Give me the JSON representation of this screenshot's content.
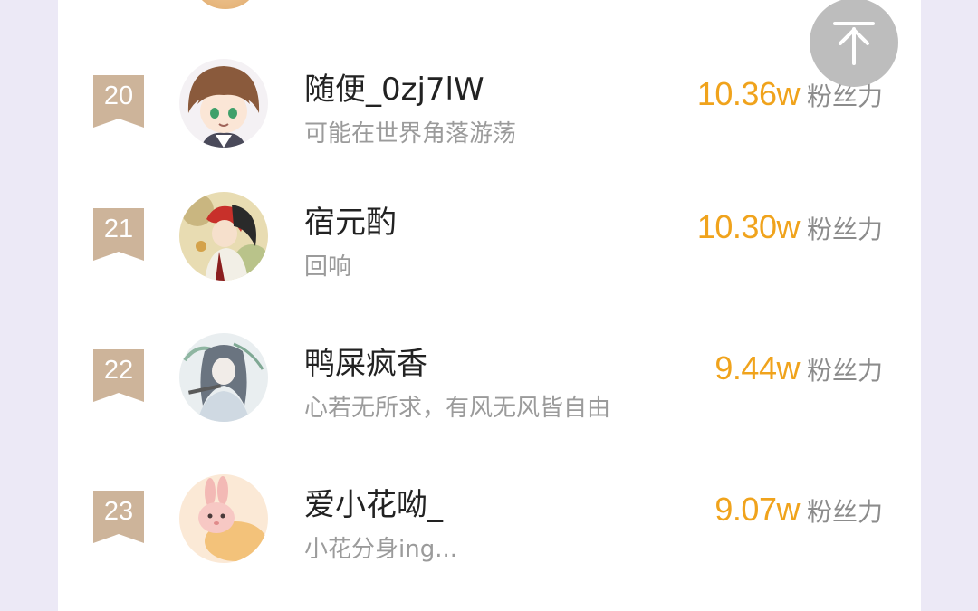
{
  "ranking": {
    "fans_label": "粉丝力",
    "rows": [
      {
        "rank": "20",
        "name": "随便_0zj7lW",
        "signature": "可能在世界角落游荡",
        "fans": "10.36w"
      },
      {
        "rank": "21",
        "name": "宿元酌",
        "signature": "回响",
        "fans": "10.30w"
      },
      {
        "rank": "22",
        "name": "鸭屎疯香",
        "signature": "心若无所求，有风无风皆自由",
        "fans": "9.44w"
      },
      {
        "rank": "23",
        "name": "爱小花呦_",
        "signature": "小花分身ing...",
        "fans": "9.07w"
      }
    ]
  },
  "colors": {
    "accent": "#f0a31c",
    "badge": "#cdb49a",
    "background": "#ece9f6"
  },
  "icons": {
    "back_to_top": "arrow-up-icon"
  }
}
